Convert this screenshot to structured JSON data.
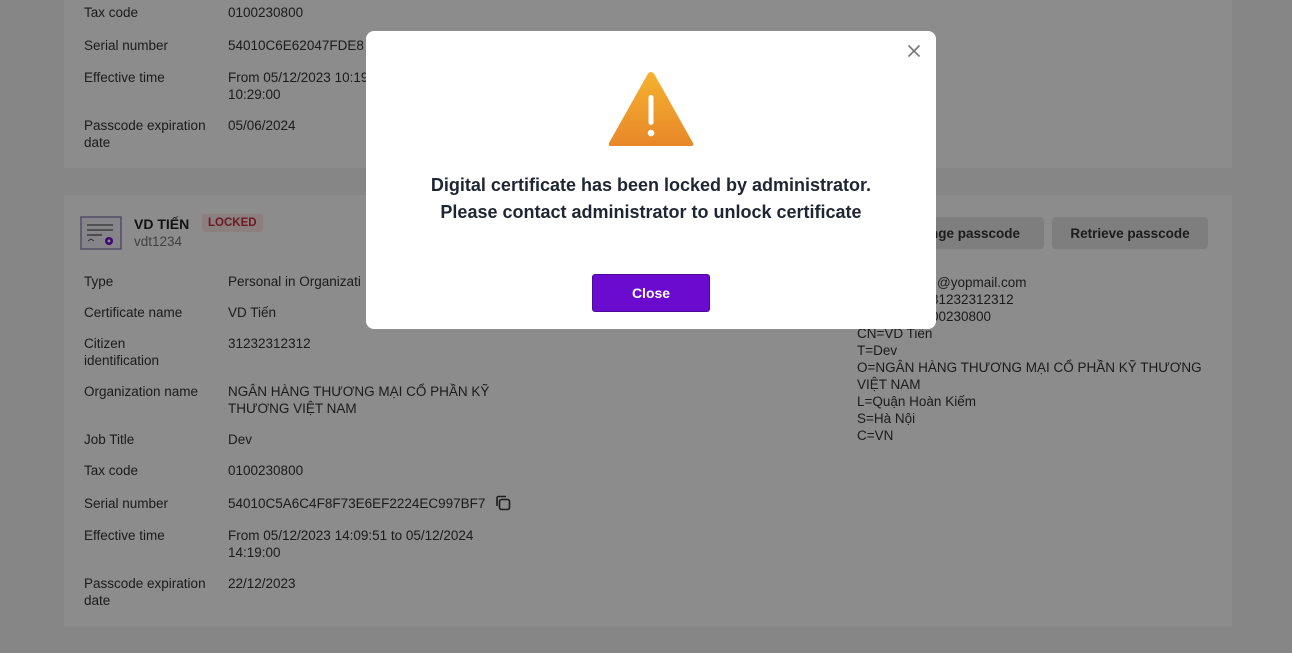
{
  "card1": {
    "rows": [
      {
        "label": "Tax code",
        "value": "0100230800"
      },
      {
        "label": "Serial number",
        "value": "54010C6E62047FDE8"
      },
      {
        "label": "Effective time",
        "value": "From 05/12/2023 10:19",
        "value2": "10:29:00"
      },
      {
        "label": "Passcode expiration",
        "label2": "date",
        "value": "05/06/2024"
      }
    ]
  },
  "card2": {
    "name": "VD TIẾN",
    "username": "vdt1234",
    "status": "LOCKED",
    "change_passcode_label": "nge passcode",
    "retrieve_passcode_label": "Retrieve passcode",
    "rows": [
      {
        "label": "Type",
        "value": "Personal in Organizati"
      },
      {
        "label": "Certificate name",
        "value": "VD Tiến"
      },
      {
        "label": "Citizen",
        "label2": "identification",
        "value": "31232312312"
      },
      {
        "label": "Organization name",
        "value": "NGÂN HÀNG THƯƠNG MẠI CỔ PHẦN KỸ",
        "value2": "THƯƠNG VIỆT NAM"
      },
      {
        "label": "Job Title",
        "value": "Dev"
      },
      {
        "label": "Tax code",
        "value": "0100230800"
      },
      {
        "label": "Serial number",
        "value": "54010C5A6C4F8F73E6EF2224EC997BF7"
      },
      {
        "label": "Effective time",
        "value": "From 05/12/2023 14:09:51 to 05/12/2024",
        "value2": "14:19:00"
      },
      {
        "label": "Passcode expiration",
        "label2": "date",
        "value": "22/12/2023"
      }
    ],
    "subject_lines": [
      "@yopmail.com",
      "31232312312",
      "00230800",
      "CN=VD Tiến",
      "T=Dev",
      "O=NGÂN HÀNG THƯƠNG MẠI CỔ PHẦN KỸ THƯƠNG",
      "VIỆT NAM",
      "L=Quận Hoàn Kiếm",
      "S=Hà Nội",
      "C=VN"
    ]
  },
  "modal": {
    "line1": "Digital certificate has been locked by administrator.",
    "line2": "Please contact administrator to unlock certificate",
    "close_label": "Close"
  },
  "colors": {
    "primary": "#6c0bd0",
    "warning": "#f0a020",
    "locked_badge": "#c83040"
  }
}
